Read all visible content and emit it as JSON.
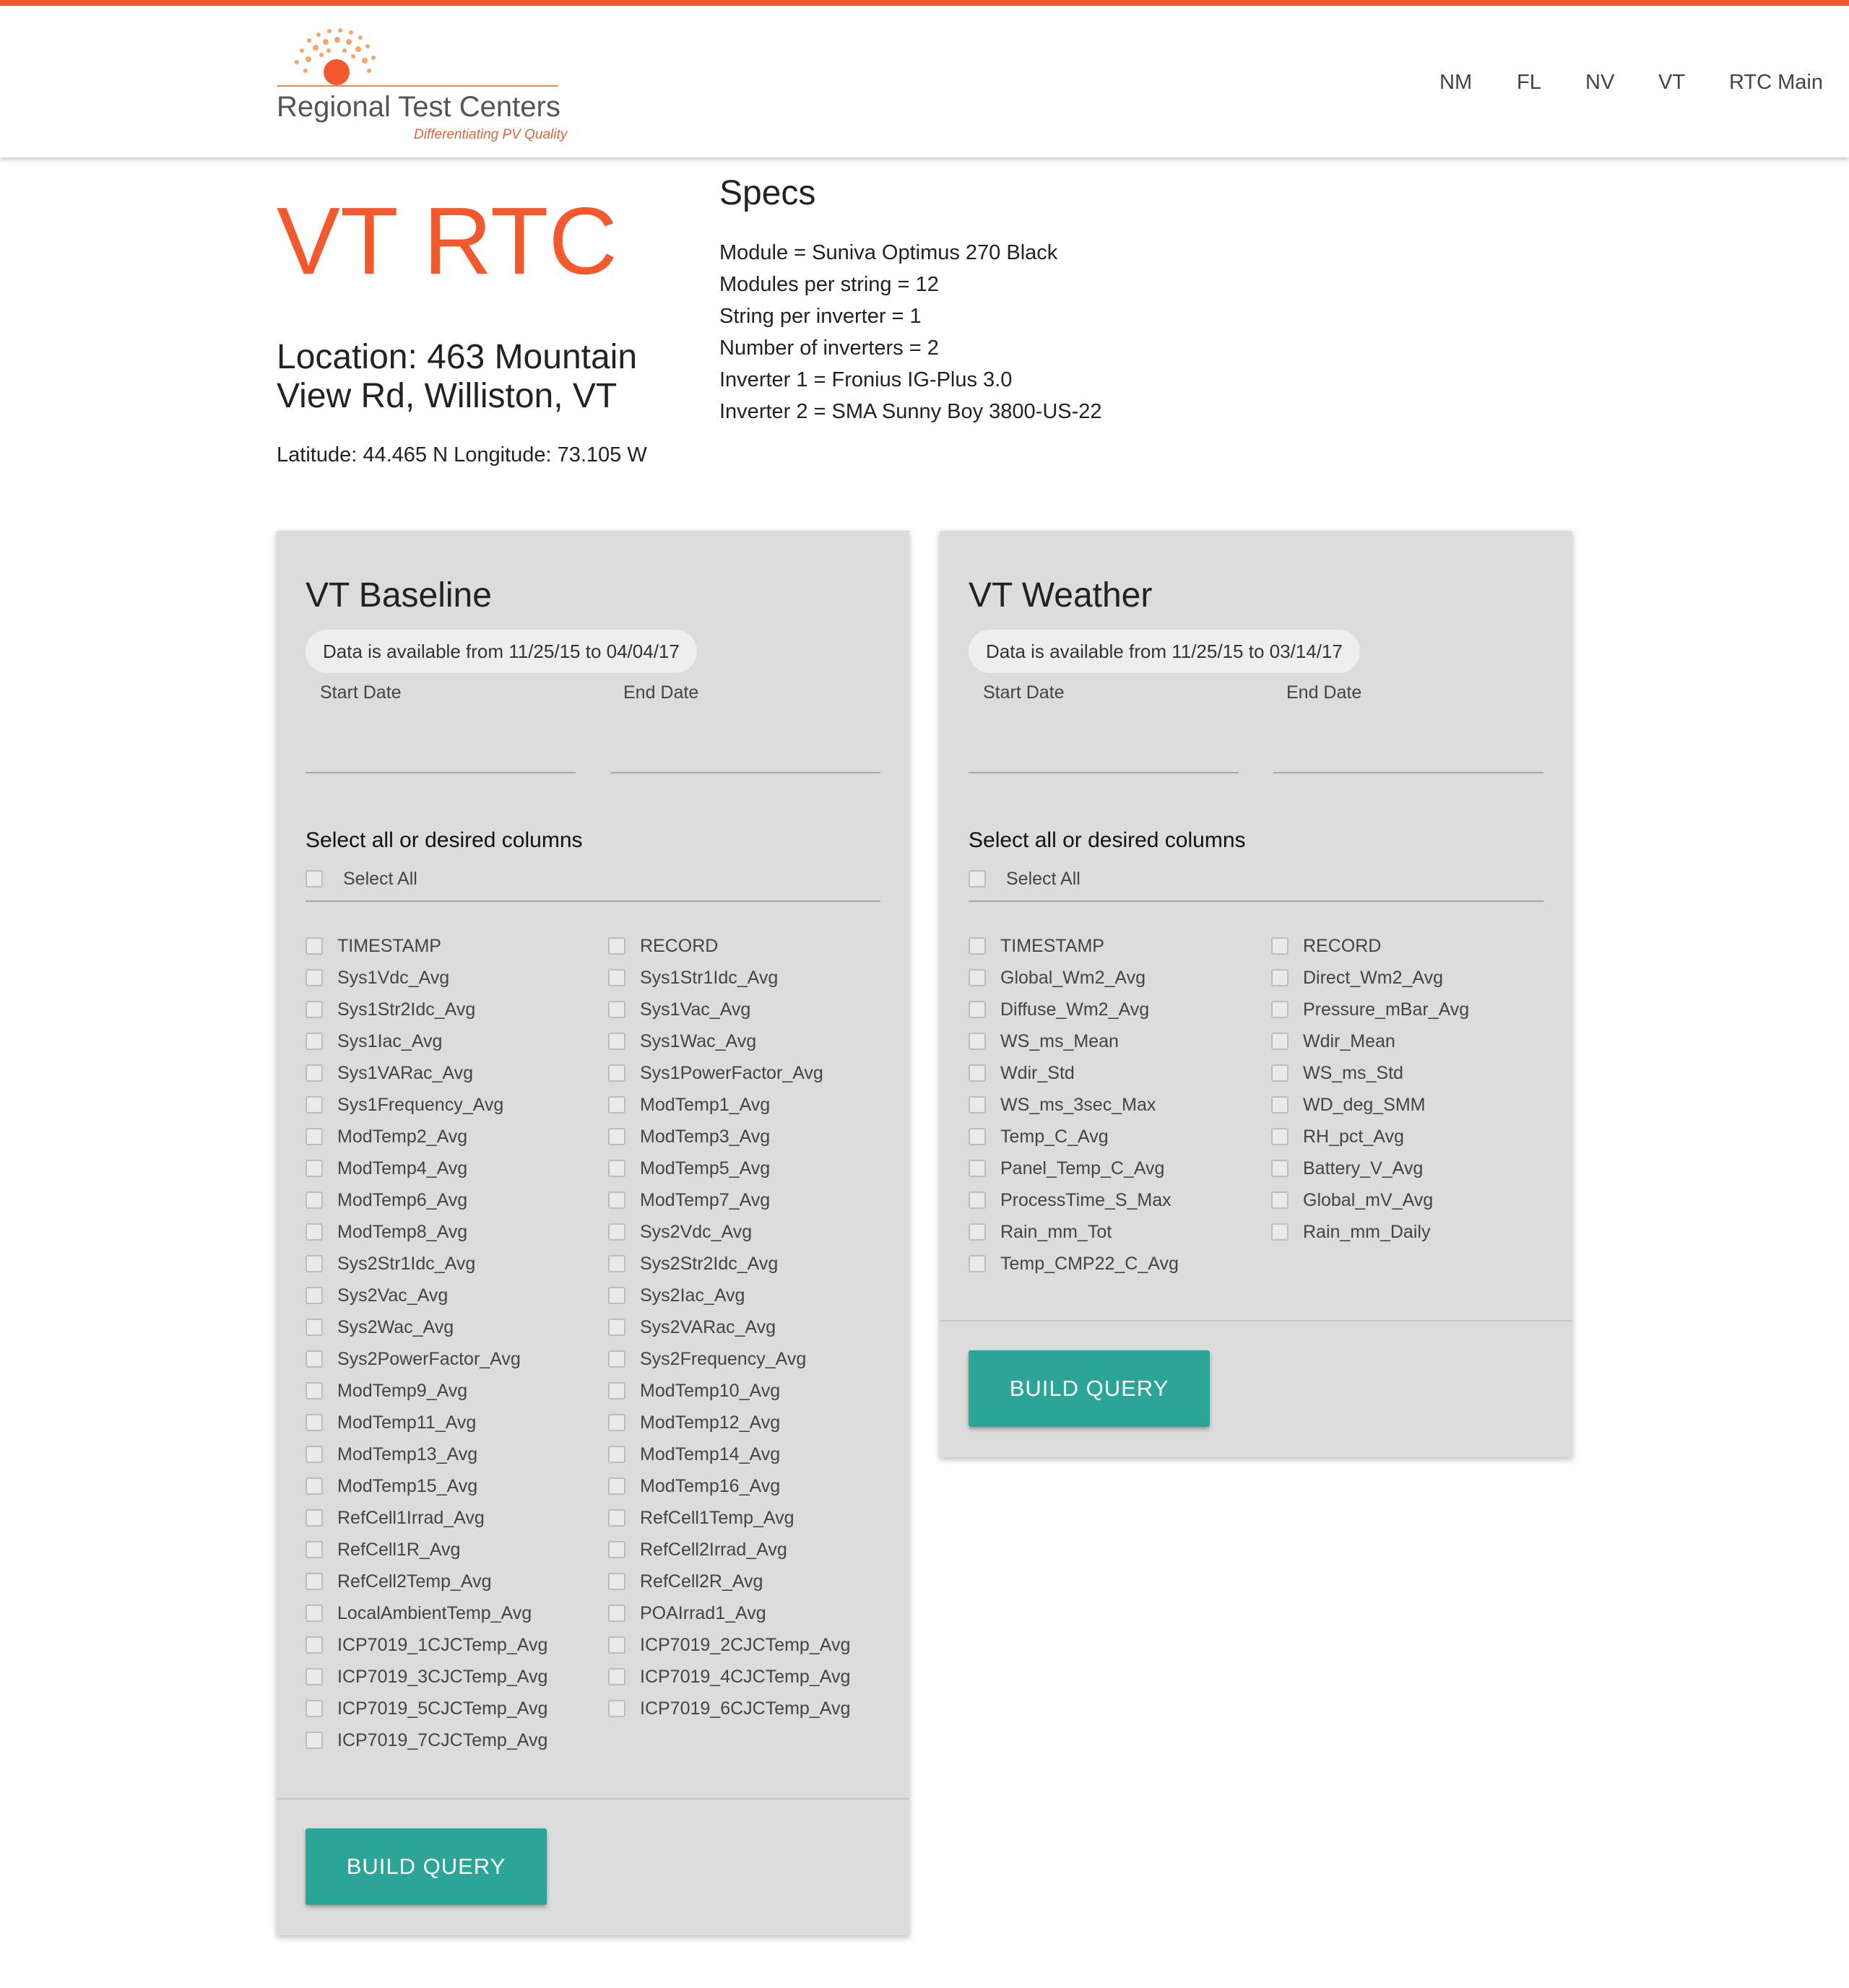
{
  "header": {
    "logo_text": "Regional Test Centers",
    "logo_tagline": "Differentiating PV Quality",
    "nav": [
      "NM",
      "FL",
      "NV",
      "VT",
      "RTC Main"
    ]
  },
  "site": {
    "title": "VT RTC",
    "location": "Location: 463 Mountain View Rd, Williston, VT",
    "latlong": "Latitude: 44.465 N Longitude: 73.105 W"
  },
  "specs": {
    "title": "Specs",
    "lines": [
      "Module = Suniva Optimus 270 Black",
      "Modules per string = 12",
      "String per inverter = 1",
      "Number of inverters = 2",
      "Inverter 1 = Fronius IG-Plus 3.0",
      "Inverter 2 = SMA Sunny Boy 3800-US-22"
    ]
  },
  "baseline": {
    "title": "VT Baseline",
    "availability": "Data is available from 11/25/15 to 04/04/17",
    "start_label": "Start Date",
    "end_label": "End Date",
    "select_heading": "Select all or desired columns",
    "select_all": "Select All",
    "columns": [
      "TIMESTAMP",
      "RECORD",
      "Sys1Vdc_Avg",
      "Sys1Str1Idc_Avg",
      "Sys1Str2Idc_Avg",
      "Sys1Vac_Avg",
      "Sys1Iac_Avg",
      "Sys1Wac_Avg",
      "Sys1VARac_Avg",
      "Sys1PowerFactor_Avg",
      "Sys1Frequency_Avg",
      "ModTemp1_Avg",
      "ModTemp2_Avg",
      "ModTemp3_Avg",
      "ModTemp4_Avg",
      "ModTemp5_Avg",
      "ModTemp6_Avg",
      "ModTemp7_Avg",
      "ModTemp8_Avg",
      "Sys2Vdc_Avg",
      "Sys2Str1Idc_Avg",
      "Sys2Str2Idc_Avg",
      "Sys2Vac_Avg",
      "Sys2Iac_Avg",
      "Sys2Wac_Avg",
      "Sys2VARac_Avg",
      "Sys2PowerFactor_Avg",
      "Sys2Frequency_Avg",
      "ModTemp9_Avg",
      "ModTemp10_Avg",
      "ModTemp11_Avg",
      "ModTemp12_Avg",
      "ModTemp13_Avg",
      "ModTemp14_Avg",
      "ModTemp15_Avg",
      "ModTemp16_Avg",
      "RefCell1Irrad_Avg",
      "RefCell1Temp_Avg",
      "RefCell1R_Avg",
      "RefCell2Irrad_Avg",
      "RefCell2Temp_Avg",
      "RefCell2R_Avg",
      "LocalAmbientTemp_Avg",
      "POAIrrad1_Avg",
      "ICP7019_1CJCTemp_Avg",
      "ICP7019_2CJCTemp_Avg",
      "ICP7019_3CJCTemp_Avg",
      "ICP7019_4CJCTemp_Avg",
      "ICP7019_5CJCTemp_Avg",
      "ICP7019_6CJCTemp_Avg",
      "ICP7019_7CJCTemp_Avg"
    ],
    "button": "BUILD QUERY"
  },
  "weather": {
    "title": "VT Weather",
    "availability": "Data is available from 11/25/15 to 03/14/17",
    "start_label": "Start Date",
    "end_label": "End Date",
    "select_heading": "Select all or desired columns",
    "select_all": "Select All",
    "columns": [
      "TIMESTAMP",
      "RECORD",
      "Global_Wm2_Avg",
      "Direct_Wm2_Avg",
      "Diffuse_Wm2_Avg",
      "Pressure_mBar_Avg",
      "WS_ms_Mean",
      "Wdir_Mean",
      "Wdir_Std",
      "WS_ms_Std",
      "WS_ms_3sec_Max",
      "WD_deg_SMM",
      "Temp_C_Avg",
      "RH_pct_Avg",
      "Panel_Temp_C_Avg",
      "Battery_V_Avg",
      "ProcessTime_S_Max",
      "Global_mV_Avg",
      "Rain_mm_Tot",
      "Rain_mm_Daily",
      "Temp_CMP22_C_Avg"
    ],
    "button": "BUILD QUERY"
  }
}
